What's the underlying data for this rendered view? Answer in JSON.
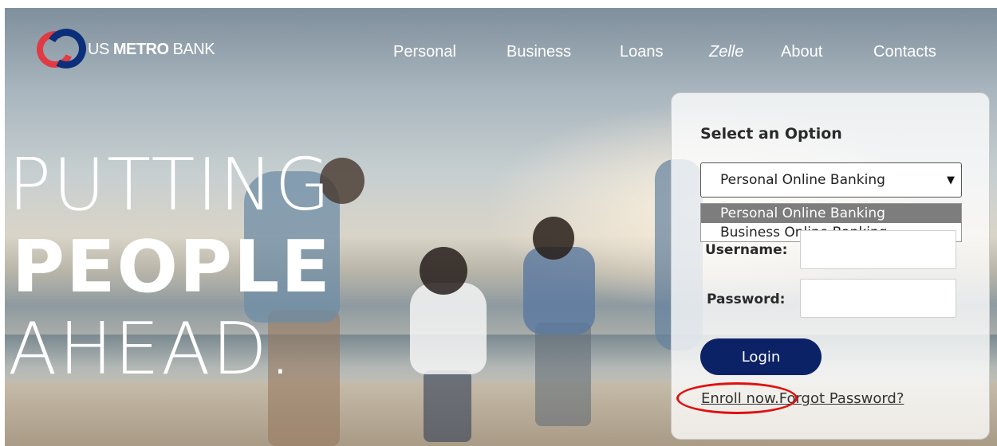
{
  "brand": {
    "logo_part1": "US ",
    "logo_part2": "METRO",
    "logo_part3": " BANK"
  },
  "nav": {
    "items": [
      "Personal",
      "Business",
      "Loans",
      "Zelle",
      "About",
      "Contacts"
    ]
  },
  "hero": {
    "line1": "PUTTING",
    "line2": "PEOPLE",
    "line3": "AHEAD."
  },
  "login": {
    "title": "Select an Option",
    "selected_option": "Personal Online Banking",
    "options": [
      "Personal Online Banking",
      "Business Online Banking"
    ],
    "username_label": "Username:",
    "password_label": "Password:",
    "button_label": "Login",
    "enroll_link": "Enroll now.",
    "forgot_link": "Forgot Password?"
  },
  "colors": {
    "accent_navy": "#0c2266",
    "logo_red": "#e23a44",
    "logo_blue": "#0b2f7a",
    "highlight_red": "#e01010"
  },
  "icons": {
    "dropdown": "chevron-down-icon"
  }
}
